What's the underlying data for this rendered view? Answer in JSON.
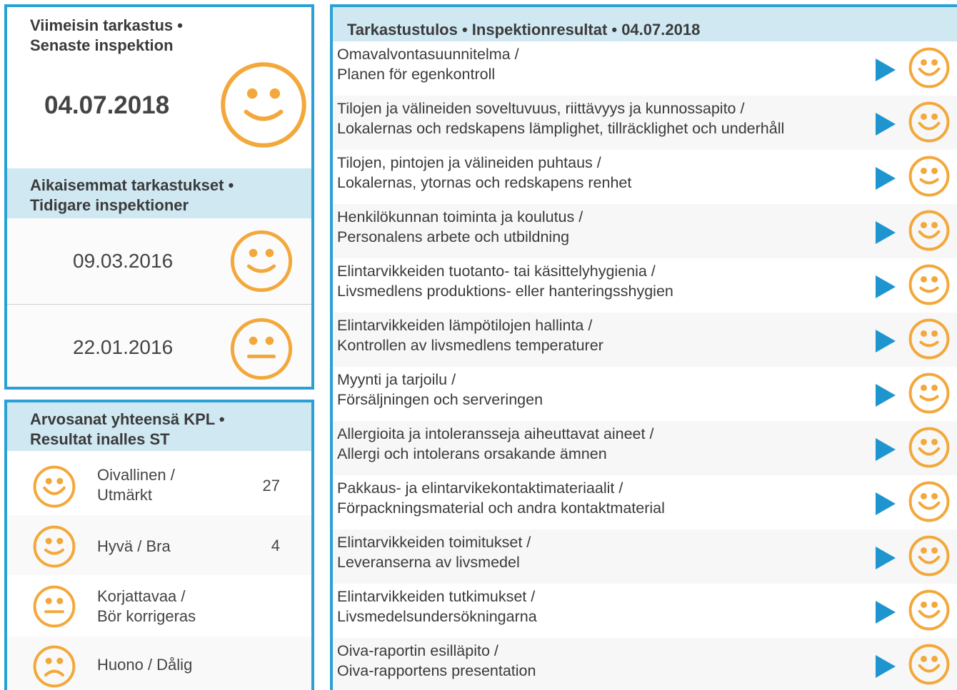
{
  "latest": {
    "title_line1": "Viimeisin tarkastus •",
    "title_line2": "Senaste inspektion",
    "date": "04.07.2018",
    "rating": "smile-icon"
  },
  "previous": {
    "title_line1": "Aikaisemmat tarkastukset •",
    "title_line2": "Tidigare inspektioner",
    "items": [
      {
        "date": "09.03.2016",
        "rating": "smile-icon"
      },
      {
        "date": "22.01.2016",
        "rating": "neutral-icon"
      }
    ]
  },
  "totals": {
    "title_line1": "Arvosanat yhteensä KPL •",
    "title_line2": "Resultat inalles ST",
    "items": [
      {
        "line1": "Oivallinen /",
        "line2": "Utmärkt",
        "count": "27",
        "icon": "big-smile-icon"
      },
      {
        "line1": "Hyvä / Bra",
        "line2": "",
        "count": "4",
        "icon": "smile-icon"
      },
      {
        "line1": "Korjattavaa /",
        "line2": "Bör korrigeras",
        "count": "",
        "icon": "neutral-icon"
      },
      {
        "line1": "Huono / Dålig",
        "line2": "",
        "count": "",
        "icon": "frown-icon"
      }
    ]
  },
  "results": {
    "title": "Tarkastustulos • Inspektionresultat • 04.07.2018",
    "rows": [
      {
        "fi": "Omavalvontasuunnitelma /",
        "sv": "Planen för egenkontroll",
        "rating": "big-smile-icon"
      },
      {
        "fi": "Tilojen ja välineiden soveltuvuus, riittävyys ja kunnossapito /",
        "sv": "Lokalernas och redskapens lämplighet, tillräcklighet och underhåll",
        "rating": "big-smile-icon"
      },
      {
        "fi": "Tilojen, pintojen ja välineiden puhtaus /",
        "sv": "Lokalernas, ytornas och redskapens renhet",
        "rating": "smile-icon"
      },
      {
        "fi": "Henkilökunnan toiminta ja koulutus /",
        "sv": "Personalens arbete och utbildning",
        "rating": "big-smile-icon"
      },
      {
        "fi": "Elintarvikkeiden tuotanto- tai käsittelyhygienia /",
        "sv": "Livsmedlens produktions- eller hanteringsshygien",
        "rating": "smile-icon"
      },
      {
        "fi": "Elintarvikkeiden lämpötilojen hallinta /",
        "sv": "Kontrollen av livsmedlens temperaturer",
        "rating": "smile-icon"
      },
      {
        "fi": "Myynti ja tarjoilu /",
        "sv": "Försäljningen och serveringen",
        "rating": "smile-icon"
      },
      {
        "fi": "Allergioita ja intoleransseja aiheuttavat aineet /",
        "sv": "Allergi och intolerans orsakande ämnen",
        "rating": "big-smile-icon"
      },
      {
        "fi": "Pakkaus- ja elintarvikekontaktimateriaalit /",
        "sv": "Förpackningsmaterial och andra kontaktmaterial",
        "rating": "big-smile-icon"
      },
      {
        "fi": "Elintarvikkeiden toimitukset /",
        "sv": "Leveranserna av livsmedel",
        "rating": "big-smile-icon"
      },
      {
        "fi": "Elintarvikkeiden tutkimukset /",
        "sv": "Livsmedelsundersökningarna",
        "rating": "big-smile-icon"
      },
      {
        "fi": "Oiva-raportin esilläpito /",
        "sv": "Oiva-rapportens presentation",
        "rating": "big-smile-icon"
      }
    ]
  },
  "colors": {
    "accent": "#2aa1d6",
    "header_bg": "#cfe8f2",
    "smiley": "#f3a83b",
    "arrow": "#1f95d0"
  }
}
